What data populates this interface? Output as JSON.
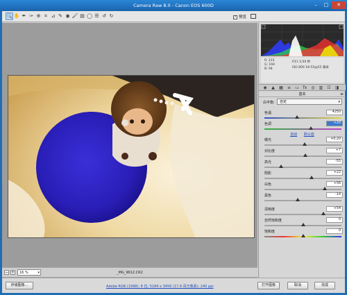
{
  "window": {
    "title": "Camera Raw 8.0  -  Canon EOS 600D",
    "min": "–",
    "max": "□",
    "close": "✕"
  },
  "toolbar": {
    "tools": [
      {
        "name": "zoom-tool",
        "glyph": "🔍"
      },
      {
        "name": "hand-tool",
        "glyph": "✋"
      },
      {
        "name": "white-balance-tool",
        "glyph": "✒"
      },
      {
        "name": "color-sampler-tool",
        "glyph": "✑"
      },
      {
        "name": "targeted-adjustment-tool",
        "glyph": "⊕"
      },
      {
        "name": "crop-tool",
        "glyph": "⌗"
      },
      {
        "name": "straighten-tool",
        "glyph": "⊿"
      },
      {
        "name": "spot-removal-tool",
        "glyph": "✎"
      },
      {
        "name": "red-eye-tool",
        "glyph": "◉"
      },
      {
        "name": "adjustment-brush-tool",
        "glyph": "🖌"
      },
      {
        "name": "graduated-filter-tool",
        "glyph": "▤"
      },
      {
        "name": "radial-filter-tool",
        "glyph": "◯"
      },
      {
        "name": "preferences-tool",
        "glyph": "☰"
      },
      {
        "name": "rotate-ccw-tool",
        "glyph": "↺"
      },
      {
        "name": "rotate-cw-tool",
        "glyph": "↻"
      }
    ],
    "preview_label": "预览",
    "preview_checked": true
  },
  "preview": {
    "zoom": "16 %",
    "filename": "_MG_9612.CR2",
    "zoom_out": "−",
    "zoom_in": "+"
  },
  "info": {
    "r": "R:  233",
    "g": "G:  194",
    "b": "B:  94",
    "aperture_shutter": "f/11    1/30 秒",
    "iso_lens": "ISO 800    18-55@55 毫米"
  },
  "panel": {
    "section_title": "基本",
    "tab_icons": [
      "◉",
      "▲",
      "▦",
      "≡",
      "▭",
      "fx",
      "◎",
      "▥",
      "☷",
      "◨"
    ],
    "white_balance_label": "白平衡:",
    "white_balance_value": "自定",
    "auto_link": "自动",
    "default_link": "默认值",
    "sliders": [
      {
        "label": "色温",
        "value": "4250",
        "pos": 0.42,
        "track": "temp",
        "selected": false
      },
      {
        "label": "色调",
        "value": "+20",
        "pos": 0.6,
        "track": "tint",
        "selected": true
      },
      {
        "label": "曝光",
        "value": "+0.20",
        "pos": 0.52,
        "track": "plain",
        "selected": false
      },
      {
        "label": "对比度",
        "value": "+7",
        "pos": 0.53,
        "track": "plain",
        "selected": false
      },
      {
        "label": "高光",
        "value": "-55",
        "pos": 0.22,
        "track": "plain",
        "selected": false
      },
      {
        "label": "阴影",
        "value": "+22",
        "pos": 0.61,
        "track": "plain",
        "selected": false
      },
      {
        "label": "白色",
        "value": "+56",
        "pos": 0.78,
        "track": "plain",
        "selected": false
      },
      {
        "label": "黑色",
        "value": "-14",
        "pos": 0.43,
        "track": "plain",
        "selected": false
      },
      {
        "label": "清晰度",
        "value": "+54",
        "pos": 0.77,
        "track": "plain",
        "selected": false
      },
      {
        "label": "自然饱和度",
        "value": "0",
        "pos": 0.5,
        "track": "plain",
        "selected": false
      },
      {
        "label": "饱和度",
        "value": "0",
        "pos": 0.5,
        "track": "sat",
        "selected": false
      }
    ]
  },
  "footer": {
    "save_button": "存储图像...",
    "workflow_link": "Adobe RGB (1998); 8 位; 5184 x 3456 (17.9 百万像素); 240 ppi",
    "open_button": "打开图像",
    "cancel_button": "取消",
    "done_button": "完成"
  }
}
